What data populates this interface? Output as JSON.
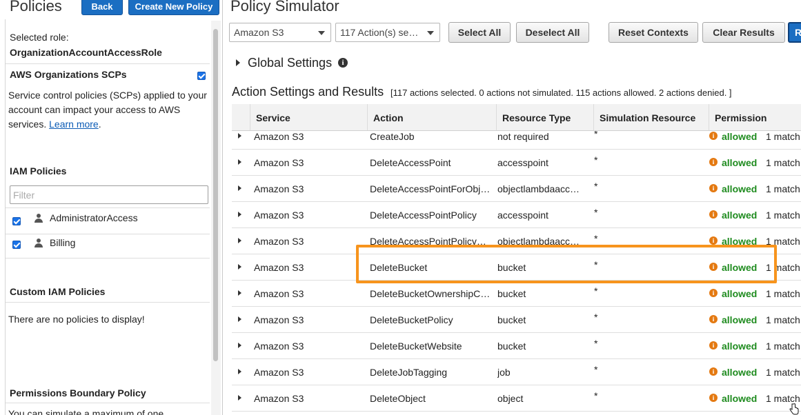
{
  "left_panel": {
    "title": "Policies",
    "back_label": "Back",
    "create_policy_label": "Create New Policy",
    "selected_role_label": "Selected role:",
    "selected_role_value": "OrganizationAccountAccessRole",
    "scp_heading": "AWS Organizations SCPs",
    "scp_checked": true,
    "scp_description": "Service control policies (SCPs) applied to your account can impact your access to AWS services.",
    "scp_learn_more": "Learn more",
    "iam_heading": "IAM Policies",
    "filter_placeholder": "Filter",
    "iam_policies": [
      {
        "name": "AdministratorAccess",
        "checked": true,
        "icon": "user-icon"
      },
      {
        "name": "Billing",
        "checked": true,
        "icon": "user-icon"
      }
    ],
    "custom_heading": "Custom IAM Policies",
    "custom_empty": "There are no policies to display!",
    "boundary_heading": "Permissions Boundary Policy",
    "boundary_text": "You can simulate a maximum of one"
  },
  "main": {
    "title": "Policy Simulator",
    "service_select": "Amazon S3",
    "actions_select": "117 Action(s) se…",
    "select_all": "Select All",
    "deselect_all": "Deselect All",
    "reset_contexts": "Reset Contexts",
    "clear_results": "Clear Results",
    "run_label": "R",
    "global_settings": "Global Settings",
    "section_title": "Action Settings and Results",
    "section_summary": "[117 actions selected. 0 actions not simulated. 115 actions allowed. 2 actions denied. ]"
  },
  "table": {
    "headers": [
      "Service",
      "Action",
      "Resource Type",
      "Simulation Resource",
      "Permission"
    ],
    "rows": [
      {
        "service": "Amazon S3",
        "action": "CreateJob",
        "resource_type": "not required",
        "sim_resource": "*",
        "permission": "allowed",
        "match": "1 match"
      },
      {
        "service": "Amazon S3",
        "action": "DeleteAccessPoint",
        "resource_type": "accesspoint",
        "sim_resource": "*",
        "permission": "allowed",
        "match": "1 match"
      },
      {
        "service": "Amazon S3",
        "action": "DeleteAccessPointForObj…",
        "resource_type": "objectlambdaacc…",
        "sim_resource": "*",
        "permission": "allowed",
        "match": "1 match"
      },
      {
        "service": "Amazon S3",
        "action": "DeleteAccessPointPolicy",
        "resource_type": "accesspoint",
        "sim_resource": "*",
        "permission": "allowed",
        "match": "1 match"
      },
      {
        "service": "Amazon S3",
        "action": "DeleteAccessPointPolicy…",
        "resource_type": "objectlambdaacc…",
        "sim_resource": "*",
        "permission": "allowed",
        "match": "1 match"
      },
      {
        "service": "Amazon S3",
        "action": "DeleteBucket",
        "resource_type": "bucket",
        "sim_resource": "*",
        "permission": "allowed",
        "match": "1 match"
      },
      {
        "service": "Amazon S3",
        "action": "DeleteBucketOwnershipC…",
        "resource_type": "bucket",
        "sim_resource": "*",
        "permission": "allowed",
        "match": "1 match"
      },
      {
        "service": "Amazon S3",
        "action": "DeleteBucketPolicy",
        "resource_type": "bucket",
        "sim_resource": "*",
        "permission": "allowed",
        "match": "1 match"
      },
      {
        "service": "Amazon S3",
        "action": "DeleteBucketWebsite",
        "resource_type": "bucket",
        "sim_resource": "*",
        "permission": "allowed",
        "match": "1 match"
      },
      {
        "service": "Amazon S3",
        "action": "DeleteJobTagging",
        "resource_type": "job",
        "sim_resource": "*",
        "permission": "allowed",
        "match": "1 match"
      },
      {
        "service": "Amazon S3",
        "action": "DeleteObject",
        "resource_type": "object",
        "sim_resource": "*",
        "permission": "allowed",
        "match": "1 match"
      }
    ],
    "highlighted_action": "DeleteBucket"
  },
  "colors": {
    "primary_button": "#1b6ec2",
    "allowed": "#1e8b1e",
    "info_orange": "#e47911",
    "highlight": "#f7941d"
  }
}
